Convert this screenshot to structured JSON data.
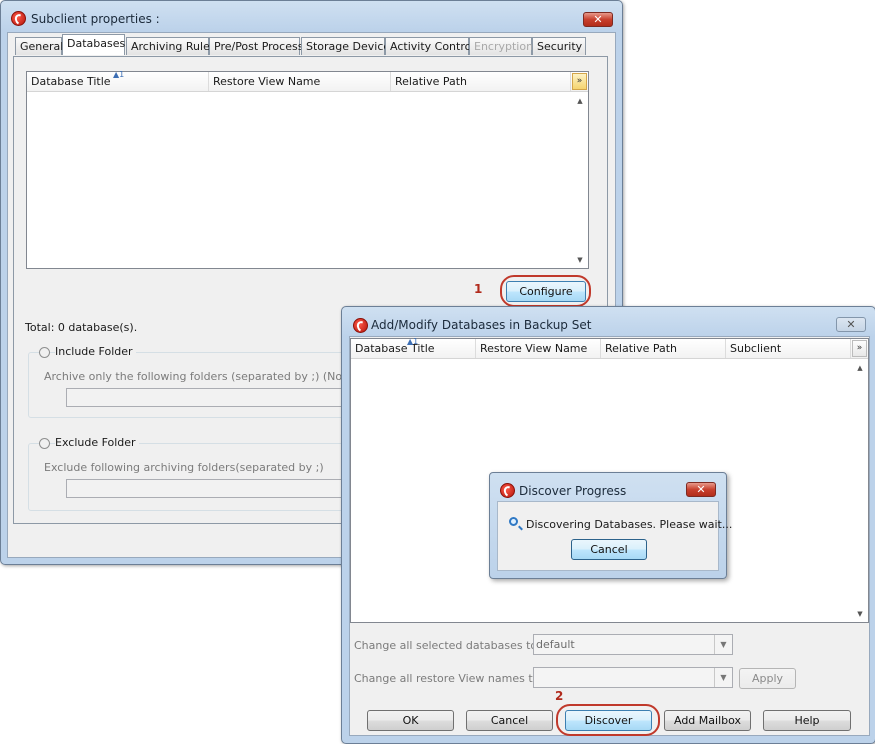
{
  "subclient_window": {
    "title": "Subclient properties :",
    "close_glyph": "✕",
    "tabs": [
      {
        "label": "General",
        "state": "normal"
      },
      {
        "label": "Databases",
        "state": "active"
      },
      {
        "label": "Archiving Rules",
        "state": "normal"
      },
      {
        "label": "Pre/Post Process",
        "state": "normal"
      },
      {
        "label": "Storage Device",
        "state": "normal"
      },
      {
        "label": "Activity Control",
        "state": "normal"
      },
      {
        "label": "Encryption",
        "state": "disabled"
      },
      {
        "label": "Security",
        "state": "normal"
      }
    ],
    "grid": {
      "columns": [
        "Database Title",
        "Restore View Name",
        "Relative Path"
      ],
      "sort_marker": "1",
      "rows": []
    },
    "configure_button": "Configure",
    "callout_number": "1",
    "total_text": "Total: 0 database(s).",
    "include_folder": {
      "label": "Include Folder",
      "description": "Archive only the following folders (separated by ;) (Note: Othe"
    },
    "exclude_folder": {
      "label": "Exclude Folder",
      "description": "Exclude following archiving folders(separated by ;)"
    }
  },
  "modify_window": {
    "title": "Add/Modify Databases in Backup Set",
    "close_glyph": "✕",
    "grid": {
      "columns": [
        "Database Title",
        "Restore View Name",
        "Relative Path",
        "Subclient"
      ],
      "sort_marker": "1",
      "rows": []
    },
    "change_databases_label": "Change all selected databases to:",
    "change_databases_value": "default",
    "change_views_label": "Change all restore View names to:",
    "change_views_value": "",
    "apply_button": "Apply",
    "callout_number": "2",
    "buttons": {
      "ok": "OK",
      "cancel": "Cancel",
      "discover": "Discover",
      "add_mailbox": "Add Mailbox",
      "help": "Help"
    }
  },
  "progress_dialog": {
    "title": "Discover Progress",
    "close_glyph": "✕",
    "message": "Discovering Databases. Please wait...",
    "cancel_button": "Cancel"
  },
  "icons": {
    "app": "commvault-app-icon",
    "scroll_up": "▲",
    "scroll_down": "▼",
    "column_chooser": "»",
    "dropdown": "▼",
    "search": "magnifier-icon"
  },
  "colors": {
    "callout": "#c0392b",
    "title_bar": "#bcd2ea",
    "close_active": "#c8402e"
  }
}
